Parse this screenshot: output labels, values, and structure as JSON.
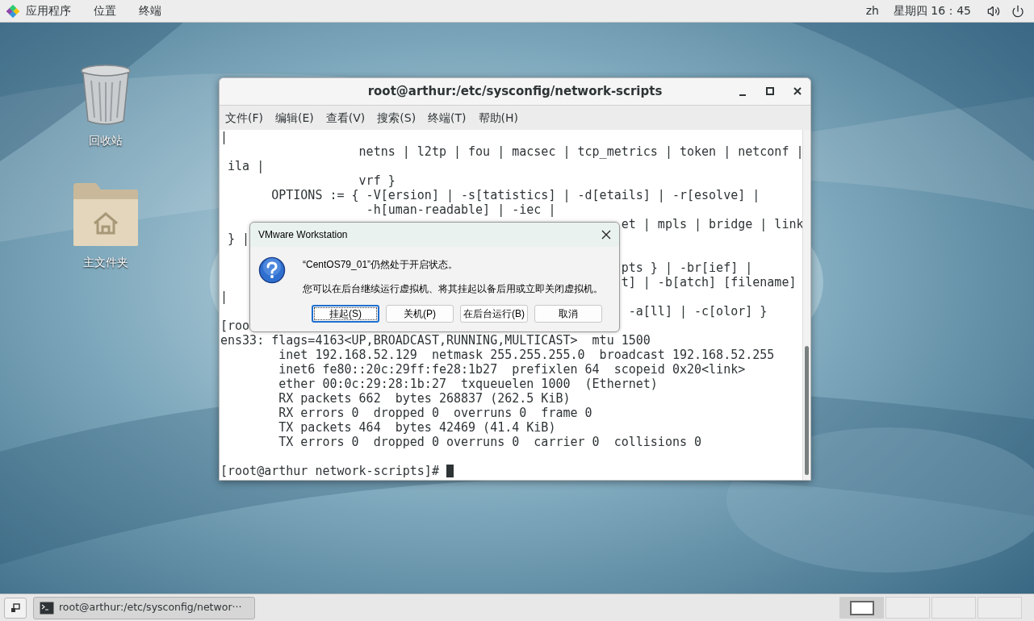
{
  "top_bar": {
    "menus": [
      "应用程序",
      "位置",
      "终端"
    ],
    "keyboard": "zh",
    "clock": "星期四 16：45"
  },
  "desktop_icons": [
    {
      "kind": "trash",
      "label": "回收站"
    },
    {
      "kind": "folder",
      "label": "主文件夹"
    }
  ],
  "terminal": {
    "title": "root@arthur:/etc/sysconfig/network-scripts",
    "menu": [
      "文件(F)",
      "编辑(E)",
      "查看(V)",
      "搜索(S)",
      "终端(T)",
      "帮助(H)"
    ],
    "lines": [
      {
        "kind": "text",
        "text": "|"
      },
      {
        "kind": "text",
        "text": "                   netns | l2tp | fou | macsec | tcp_metrics | token | netconf |"
      },
      {
        "kind": "text",
        "text": " ila |"
      },
      {
        "kind": "text",
        "text": "                   vrf }"
      },
      {
        "kind": "text",
        "text": "       OPTIONS := { -V[ersion] | -s[tatistics] | -d[etails] | -r[esolve] |"
      },
      {
        "kind": "text",
        "text": "                    -h[uman-readable] | -iec |"
      },
      {
        "kind": "text",
        "text": "                                                       et | mpls | bridge | link"
      },
      {
        "kind": "text",
        "text": " } |"
      },
      {
        "kind": "blank"
      },
      {
        "kind": "text",
        "text": "                                                       pts } | -br[ief] |"
      },
      {
        "kind": "text",
        "text": "                                                       t] | -b[atch] [filename]"
      },
      {
        "kind": "text",
        "text": "|"
      },
      {
        "kind": "text",
        "text": "                                                        -a[ll] | -c[olor] }"
      },
      {
        "kind": "text",
        "text": "[roo"
      },
      {
        "kind": "text",
        "text": "ens33: flags=4163<UP,BROADCAST,RUNNING,MULTICAST>  mtu 1500"
      },
      {
        "kind": "text",
        "text": "        inet 192.168.52.129  netmask 255.255.255.0  broadcast 192.168.52.255"
      },
      {
        "kind": "text",
        "text": "        inet6 fe80::20c:29ff:fe28:1b27  prefixlen 64  scopeid 0x20<link>"
      },
      {
        "kind": "text",
        "text": "        ether 00:0c:29:28:1b:27  txqueuelen 1000  (Ethernet)"
      },
      {
        "kind": "text",
        "text": "        RX packets 662  bytes 268837 (262.5 KiB)"
      },
      {
        "kind": "text",
        "text": "        RX errors 0  dropped 0  overruns 0  frame 0"
      },
      {
        "kind": "text",
        "text": "        TX packets 464  bytes 42469 (41.4 KiB)"
      },
      {
        "kind": "text",
        "text": "        TX errors 0  dropped 0 overruns 0  carrier 0  collisions 0"
      },
      {
        "kind": "blank"
      },
      {
        "kind": "prompt",
        "text": "[root@arthur network-scripts]# "
      }
    ]
  },
  "dialog": {
    "title": "VMware Workstation",
    "message": "“CentOS79_01”仍然处于开启状态。",
    "detail": "您可以在后台继续运行虚拟机、将其挂起以备后用或立即关闭虚拟机。",
    "buttons": [
      {
        "label": "挂起(S)",
        "focused": true
      },
      {
        "label": "关机(P)",
        "focused": false
      },
      {
        "label": "在后台运行(B)",
        "focused": false
      },
      {
        "label": "取消",
        "focused": false
      }
    ]
  },
  "taskbar": {
    "task": "root@arthur:/etc/sysconfig/networ···",
    "workspaces": [
      {
        "selected": true
      },
      {
        "selected": false
      },
      {
        "selected": false
      },
      {
        "selected": false
      }
    ]
  }
}
